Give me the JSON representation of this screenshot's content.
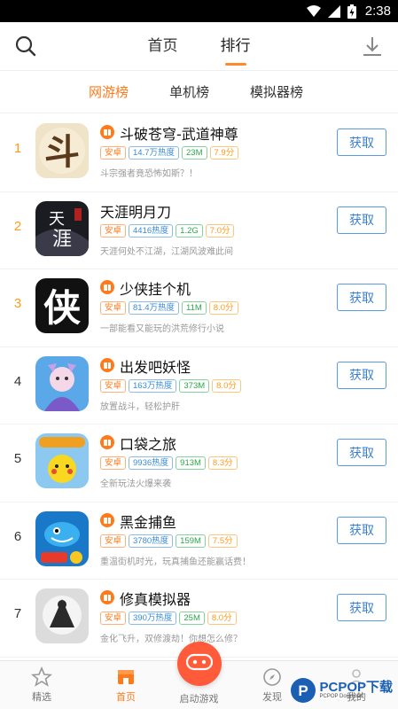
{
  "statusbar": {
    "time": "2:38"
  },
  "topnav": {
    "tabs": [
      {
        "label": "首页",
        "active": false
      },
      {
        "label": "排行",
        "active": true
      }
    ]
  },
  "subtabs": [
    {
      "label": "网游榜",
      "active": true
    },
    {
      "label": "单机榜",
      "active": false
    },
    {
      "label": "模拟器榜",
      "active": false
    }
  ],
  "games": [
    {
      "rank": "1",
      "title": "斗破苍穹-武道神尊",
      "os": "安卓",
      "heat": "14.7万热度",
      "size": "23M",
      "score": "7.9分",
      "desc": "斗宗强者竟恐怖如斯？！",
      "btn": "获取",
      "icon": "dou-icon"
    },
    {
      "rank": "2",
      "title": "天涯明月刀",
      "os": "安卓",
      "heat": "4416热度",
      "size": "1.2G",
      "score": "7.0分",
      "desc": "天涯何处不江湖，江湖风波难此间",
      "btn": "获取",
      "icon": "tianya-icon"
    },
    {
      "rank": "3",
      "title": "少侠挂个机",
      "os": "安卓",
      "heat": "81.4万热度",
      "size": "11M",
      "score": "8.0分",
      "desc": "一部能看又能玩的洪荒修行小说",
      "btn": "获取",
      "icon": "xia-icon"
    },
    {
      "rank": "4",
      "title": "出发吧妖怪",
      "os": "安卓",
      "heat": "163万热度",
      "size": "373M",
      "score": "8.0分",
      "desc": "放置战斗，轻松护肝",
      "btn": "获取",
      "icon": "yaoguai-icon"
    },
    {
      "rank": "5",
      "title": "口袋之旅",
      "os": "安卓",
      "heat": "9936热度",
      "size": "913M",
      "score": "8.3分",
      "desc": "全新玩法火爆来袭",
      "btn": "获取",
      "icon": "pocket-icon"
    },
    {
      "rank": "6",
      "title": "黑金捕鱼",
      "os": "安卓",
      "heat": "3780热度",
      "size": "159M",
      "score": "7.5分",
      "desc": "重温街机时光，玩真捕鱼还能赢话费！",
      "btn": "获取",
      "icon": "fish-icon"
    },
    {
      "rank": "7",
      "title": "修真模拟器",
      "os": "安卓",
      "heat": "390万热度",
      "size": "25M",
      "score": "8.0分",
      "desc": "金化飞升，双修渡劫！你想怎么修？",
      "btn": "获取",
      "icon": "xiuzhen-icon"
    }
  ],
  "bottombar": {
    "items": [
      {
        "label": "精选",
        "active": false
      },
      {
        "label": "首页",
        "active": true
      },
      {
        "label": "启动游戏",
        "active": false
      },
      {
        "label": "发现",
        "active": false
      },
      {
        "label": "我的",
        "active": false
      }
    ]
  },
  "watermark": {
    "text": "PCPOP下载",
    "sub": "PCPOP Download"
  },
  "colors": {
    "accent": "#ff7a1a",
    "button": "#3c7fd0",
    "center": "#ff5a3a"
  }
}
